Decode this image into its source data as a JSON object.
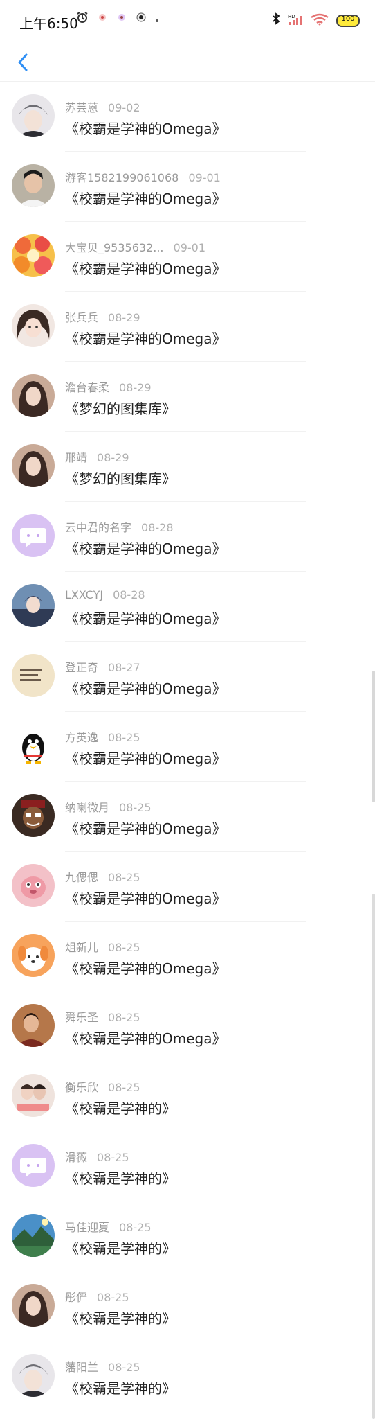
{
  "status_bar": {
    "time": "上午6:50",
    "battery": "100",
    "icons": [
      "alarm-icon",
      "app-icon",
      "app-icon",
      "app-icon",
      "dot-icon",
      "bluetooth-icon",
      "signal-icon",
      "wifi-icon",
      "battery-icon"
    ]
  },
  "header": {
    "back_icon": "chevron-left-icon",
    "accent_color": "#2f8ff5"
  },
  "entries": [
    {
      "name": "苏芸蒽",
      "date": "09-02",
      "book": "《校霸是学神的Omega》",
      "avatar": "anime-boy-avatar"
    },
    {
      "name": "游客1582199061068",
      "date": "09-01",
      "book": "《校霸是学神的Omega》",
      "avatar": "man-photo-avatar"
    },
    {
      "name": "大宝贝_9535632...",
      "date": "09-01",
      "book": "《校霸是学神的Omega》",
      "avatar": "fruit-avatar"
    },
    {
      "name": "张兵兵",
      "date": "08-29",
      "book": "《校霸是学神的Omega》",
      "avatar": "anime-girl-avatar"
    },
    {
      "name": "澹台春柔",
      "date": "08-29",
      "book": "《梦幻的图集库》",
      "avatar": "girl-photo-avatar"
    },
    {
      "name": "邢靖",
      "date": "08-29",
      "book": "《梦幻的图集库》",
      "avatar": "girl-photo-avatar"
    },
    {
      "name": "云中君的名字",
      "date": "08-28",
      "book": "《校霸是学神的Omega》",
      "avatar": "chat-bubble-avatar"
    },
    {
      "name": "LXXCYJ",
      "date": "08-28",
      "book": "《校霸是学神的Omega》",
      "avatar": "anime-scene-avatar"
    },
    {
      "name": "登正奇",
      "date": "08-27",
      "book": "《校霸是学神的Omega》",
      "avatar": "text-note-avatar"
    },
    {
      "name": "方英逸",
      "date": "08-25",
      "book": "《校霸是学神的Omega》",
      "avatar": "penguin-avatar"
    },
    {
      "name": "纳喇微月",
      "date": "08-25",
      "book": "《校霸是学神的Omega》",
      "avatar": "cartoon-man-avatar"
    },
    {
      "name": "九偲偲",
      "date": "08-25",
      "book": "《校霸是学神的Omega》",
      "avatar": "pink-cartoon-avatar"
    },
    {
      "name": "俎新儿",
      "date": "08-25",
      "book": "《校霸是学神的Omega》",
      "avatar": "dog-cartoon-avatar"
    },
    {
      "name": "舜乐圣",
      "date": "08-25",
      "book": "《校霸是学神的Omega》",
      "avatar": "person-photo-avatar"
    },
    {
      "name": "衡乐欣",
      "date": "08-25",
      "book": "《校霸是学神的》",
      "avatar": "couple-photo-avatar"
    },
    {
      "name": "滑薇",
      "date": "08-25",
      "book": "《校霸是学神的》",
      "avatar": "chat-bubble-avatar"
    },
    {
      "name": "马佳迎夏",
      "date": "08-25",
      "book": "《校霸是学神的》",
      "avatar": "landscape-avatar"
    },
    {
      "name": "彤俨",
      "date": "08-25",
      "book": "《校霸是学神的》",
      "avatar": "girl-photo-avatar"
    },
    {
      "name": "藩阳兰",
      "date": "08-25",
      "book": "《校霸是学神的》",
      "avatar": "anime-boy-avatar"
    }
  ]
}
